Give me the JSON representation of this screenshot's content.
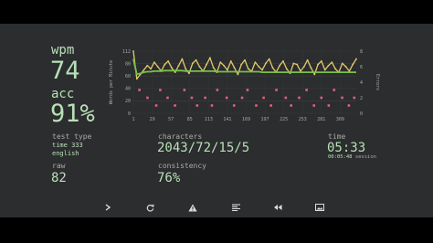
{
  "results": {
    "wpm_label": "wpm",
    "wpm_value": "74",
    "acc_label": "acc",
    "acc_value": "91%",
    "test_type_label": "test type",
    "test_type_line1": "time 333",
    "test_type_line2": "english",
    "raw_label": "raw",
    "raw_value": "82",
    "characters_label": "characters",
    "characters_value": "2043/72/15/5",
    "consistency_label": "consistency",
    "consistency_value": "76%",
    "time_label": "time",
    "time_value": "05:33",
    "session_time": "00:05:48",
    "session_label": "session"
  },
  "toolbar": {
    "next_icon": "chevron-right-icon",
    "restart_icon": "refresh-icon",
    "report_icon": "warning-icon",
    "words_icon": "list-icon",
    "replay_icon": "rewind-icon",
    "screenshot_icon": "image-icon"
  },
  "colors": {
    "background": "#2b2d2e",
    "accent": "#b8e0b8",
    "raw_line": "#e2c96b",
    "wpm_line": "#7bc04a",
    "errors": "#e0607e",
    "label": "#aaaaaa"
  },
  "chart_data": {
    "type": "line",
    "ylabel": "Words per Minute",
    "y2label": "Errors",
    "ylim": [
      0,
      112
    ],
    "y_ticks": [
      "112",
      "80",
      "60",
      "40",
      "20",
      "0"
    ],
    "y2lim": [
      0,
      8
    ],
    "y2_ticks": [
      "8",
      "6",
      "4",
      "2",
      "0"
    ],
    "x_ticks": [
      "1",
      "29",
      "57",
      "85",
      "113",
      "141",
      "169",
      "197",
      "225",
      "253",
      "281",
      "309"
    ],
    "xlim": [
      1,
      333
    ],
    "grid": true,
    "raw_amplitude": 14,
    "series": [
      {
        "key": "raw",
        "color": "#e2c96b",
        "values": [
          112,
          62,
          70,
          78,
          86,
          80,
          92,
          84,
          76,
          88,
          94,
          82,
          74,
          86,
          98,
          80,
          72,
          90,
          96,
          84,
          76,
          88,
          100,
          82,
          74,
          92,
          86,
          78,
          94,
          82,
          70,
          88,
          96,
          80,
          76,
          92,
          84,
          78,
          90,
          98,
          82,
          74,
          86,
          94,
          80,
          72,
          90,
          88,
          76,
          84,
          96,
          82,
          70,
          88,
          94,
          78,
          86,
          92,
          80,
          74,
          90,
          84,
          76,
          88,
          98
        ]
      },
      {
        "key": "wpm",
        "color": "#7bc04a",
        "values": [
          98,
          70,
          72,
          74,
          75,
          75,
          76,
          76,
          76,
          77,
          77,
          77,
          77,
          77,
          77,
          76,
          76,
          76,
          76,
          76,
          76,
          76,
          76,
          76,
          75,
          75,
          75,
          75,
          75,
          75,
          75,
          75,
          75,
          75,
          75,
          75,
          75,
          74,
          74,
          74,
          74,
          74,
          74,
          74,
          74,
          74,
          74,
          74,
          74,
          74,
          74,
          74,
          74,
          74,
          74,
          74,
          74,
          74,
          74,
          74,
          74,
          74,
          74,
          74,
          74
        ]
      }
    ],
    "errors": [
      {
        "x": 10,
        "y": 3
      },
      {
        "x": 22,
        "y": 2
      },
      {
        "x": 35,
        "y": 1
      },
      {
        "x": 41,
        "y": 3
      },
      {
        "x": 52,
        "y": 2
      },
      {
        "x": 63,
        "y": 1
      },
      {
        "x": 77,
        "y": 3
      },
      {
        "x": 88,
        "y": 2
      },
      {
        "x": 96,
        "y": 1
      },
      {
        "x": 108,
        "y": 2
      },
      {
        "x": 118,
        "y": 1
      },
      {
        "x": 126,
        "y": 3
      },
      {
        "x": 140,
        "y": 2
      },
      {
        "x": 151,
        "y": 1
      },
      {
        "x": 163,
        "y": 2
      },
      {
        "x": 171,
        "y": 3
      },
      {
        "x": 184,
        "y": 1
      },
      {
        "x": 195,
        "y": 2
      },
      {
        "x": 206,
        "y": 1
      },
      {
        "x": 214,
        "y": 3
      },
      {
        "x": 228,
        "y": 2
      },
      {
        "x": 236,
        "y": 1
      },
      {
        "x": 248,
        "y": 2
      },
      {
        "x": 259,
        "y": 3
      },
      {
        "x": 270,
        "y": 1
      },
      {
        "x": 281,
        "y": 2
      },
      {
        "x": 292,
        "y": 1
      },
      {
        "x": 300,
        "y": 3
      },
      {
        "x": 312,
        "y": 2
      },
      {
        "x": 322,
        "y": 1
      },
      {
        "x": 330,
        "y": 2
      }
    ]
  }
}
